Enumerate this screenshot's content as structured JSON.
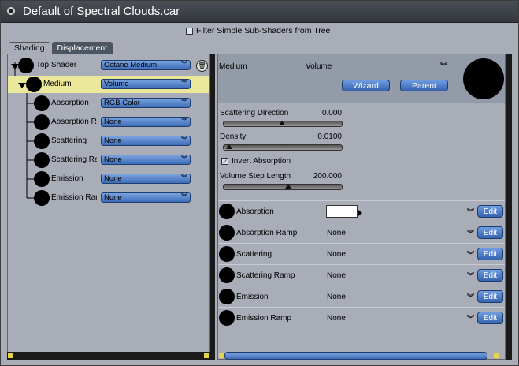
{
  "window": {
    "title": "Default of Spectral Clouds.car"
  },
  "filter": {
    "label": "Filter Simple Sub-Shaders from Tree",
    "checked": false
  },
  "tabs": [
    {
      "label": "Shading",
      "active": true
    },
    {
      "label": "Displacement",
      "active": false
    }
  ],
  "tree": {
    "top": {
      "label": "Top Shader",
      "value": "Octane Medium"
    },
    "medium": {
      "label": "Medium",
      "value": "Volume"
    },
    "children": [
      {
        "label": "Absorption",
        "value": "RGB Color"
      },
      {
        "label": "Absorption Rai",
        "value": "None"
      },
      {
        "label": "Scattering",
        "value": "None"
      },
      {
        "label": "Scattering Rar",
        "value": "None"
      },
      {
        "label": "Emission",
        "value": "None"
      },
      {
        "label": "Emission Ram",
        "value": "None"
      }
    ]
  },
  "header": {
    "name": "Medium",
    "type": "Volume",
    "wizard_label": "Wizard",
    "parent_label": "Parent"
  },
  "params": {
    "scattering_direction": {
      "label": "Scattering Direction",
      "value": "0.000",
      "level": 0.5
    },
    "density": {
      "label": "Density",
      "value": "0.0100",
      "level": 0.05
    },
    "invert_absorption": {
      "label": "Invert Absorption",
      "checked": true
    },
    "volume_step": {
      "label": "Volume Step Length",
      "value": "200.000",
      "level": 0.55
    }
  },
  "subshaders": [
    {
      "name": "Absorption",
      "value": "",
      "swatch": "#ffffff",
      "edit": "Edit"
    },
    {
      "name": "Absorption Ramp",
      "value": "None",
      "edit": "Edit"
    },
    {
      "name": "Scattering",
      "value": "None",
      "edit": "Edit"
    },
    {
      "name": "Scattering Ramp",
      "value": "None",
      "edit": "Edit"
    },
    {
      "name": "Emission",
      "value": "None",
      "edit": "Edit"
    },
    {
      "name": "Emission Ramp",
      "value": "None",
      "edit": "Edit"
    }
  ],
  "colors": {
    "accent": "#4a7fcf",
    "selection": "#ece89a",
    "panel": "#a9adb8"
  }
}
